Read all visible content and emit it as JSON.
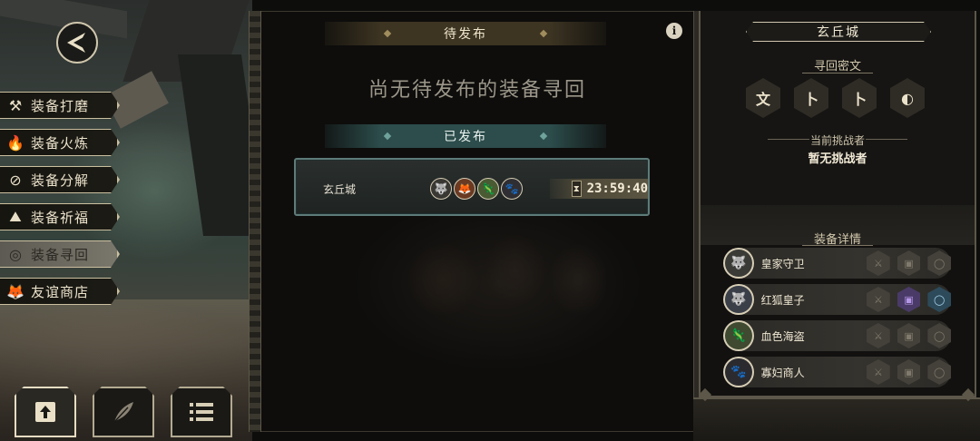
{
  "menu": {
    "items": [
      {
        "label": "装备打磨",
        "icon": "hammer-icon",
        "glyph": "⚒",
        "active": false
      },
      {
        "label": "装备火炼",
        "icon": "fire-icon",
        "glyph": "🔥",
        "active": false
      },
      {
        "label": "装备分解",
        "icon": "disassemble-icon",
        "glyph": "⊘",
        "active": false
      },
      {
        "label": "装备祈福",
        "icon": "prayer-icon",
        "glyph": "⛰",
        "active": false
      },
      {
        "label": "装备寻回",
        "icon": "retrieve-icon",
        "glyph": "◎",
        "active": true
      },
      {
        "label": "友谊商店",
        "icon": "fox-icon",
        "glyph": "🦊",
        "active": false
      }
    ]
  },
  "bottom_nav": [
    "publish-icon",
    "feather-icon",
    "list-icon"
  ],
  "center": {
    "pending_title": "待发布",
    "empty_message": "尚无待发布的装备寻回",
    "published_title": "已发布",
    "quest": {
      "city": "玄丘城",
      "avatars": [
        "🐺",
        "🦊",
        "🦎",
        "🐾"
      ],
      "timer": "23:59:40"
    }
  },
  "right": {
    "city_title": "玄丘城",
    "cipher_label": "寻回密文",
    "ciphers": [
      "文",
      "卜",
      "卜",
      "◐"
    ],
    "challenger_label": "当前挑战者",
    "challenger_value": "暂无挑战者",
    "details_label": "装备详情",
    "heroes": [
      {
        "name": "皇家守卫",
        "avatar": "🐺",
        "armor": false,
        "ring": false
      },
      {
        "name": "红狐皇子",
        "avatar": "🐺",
        "armor": true,
        "ring": true
      },
      {
        "name": "血色海盗",
        "avatar": "🦎",
        "armor": false,
        "ring": false
      },
      {
        "name": "寡妇商人",
        "avatar": "🐾",
        "armor": false,
        "ring": false
      }
    ]
  },
  "colors": {
    "accent_gold": "#cbbf9f",
    "teal": "#2c4d4c",
    "armor_purple": "#4a3a68",
    "ring_blue": "#2d4a5a"
  }
}
